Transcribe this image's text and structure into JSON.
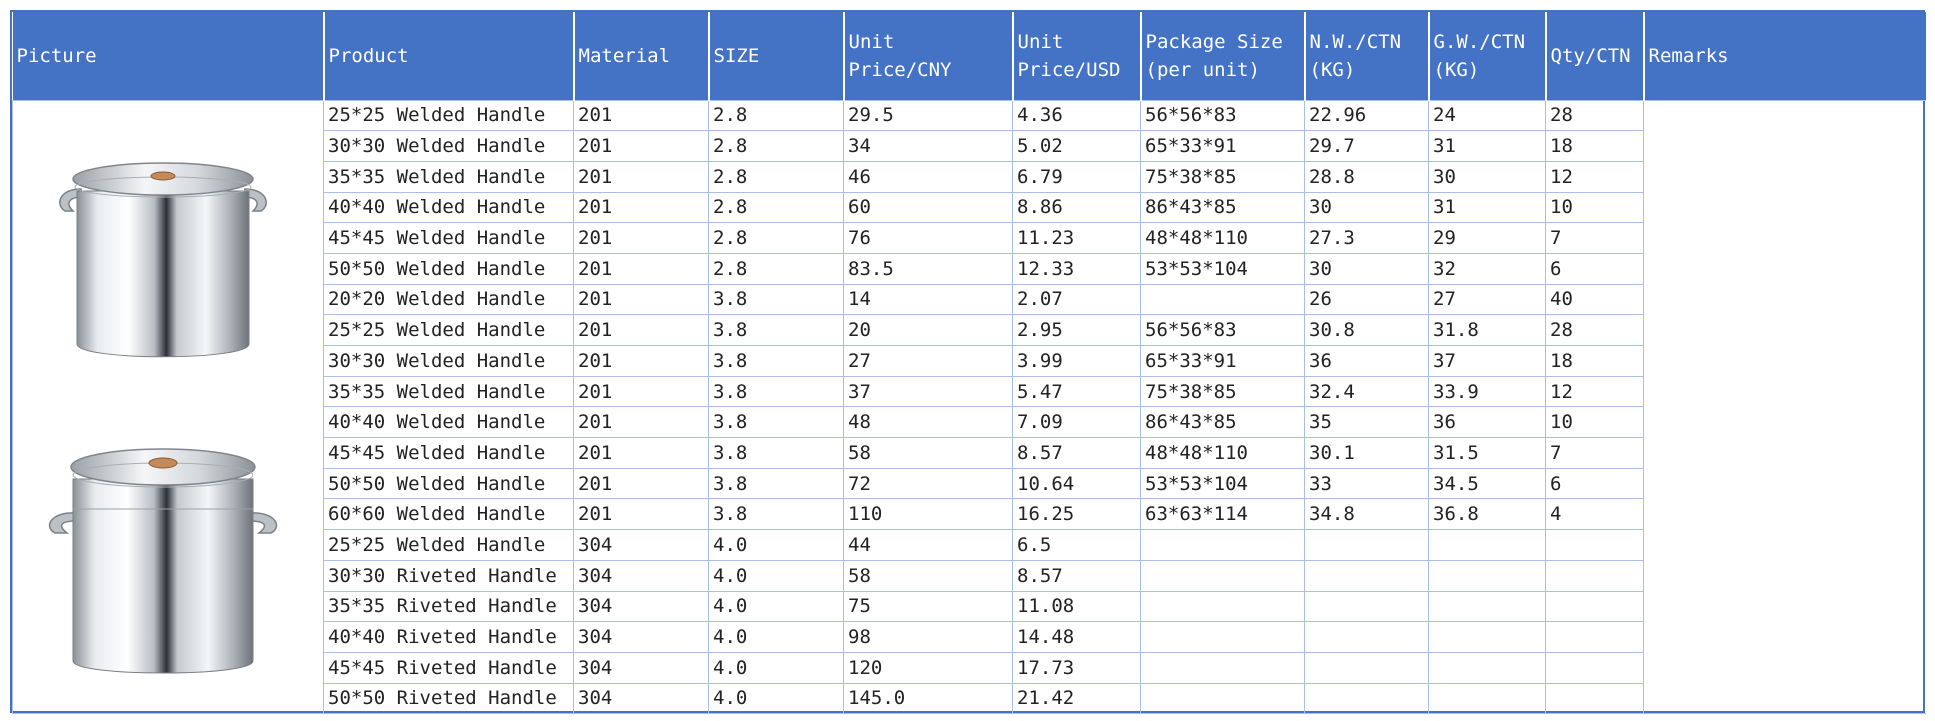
{
  "headers": {
    "picture": "Picture",
    "product": "Product",
    "material": "Material",
    "size": "SIZE",
    "unit_price_cny": "Unit\nPrice/CNY",
    "unit_price_usd": "Unit\nPrice/USD",
    "package_size": "Package Size\n(per unit)",
    "nw_ctn": "N.W./CTN\n(KG)",
    "gw_ctn": "G.W./CTN\n(KG)",
    "qty_ctn": "Qty/CTN",
    "remarks": "Remarks"
  },
  "images": [
    {
      "icon": "stock-pot-welded-handle-image"
    },
    {
      "icon": "stock-pot-riveted-handle-image"
    }
  ],
  "rows": [
    [
      "25*25 Welded Handle",
      "201",
      "2.8",
      "29.5",
      "4.36",
      "56*56*83",
      "22.96",
      "24",
      "28"
    ],
    [
      "30*30 Welded Handle",
      "201",
      "2.8",
      "34",
      "5.02",
      "65*33*91",
      "29.7",
      "31",
      "18"
    ],
    [
      "35*35 Welded Handle",
      "201",
      "2.8",
      "46",
      "6.79",
      "75*38*85",
      "28.8",
      "30",
      "12"
    ],
    [
      "40*40 Welded Handle",
      "201",
      "2.8",
      "60",
      "8.86",
      "86*43*85",
      "30",
      "31",
      "10"
    ],
    [
      "45*45 Welded Handle",
      "201",
      "2.8",
      "76",
      "11.23",
      "48*48*110",
      "27.3",
      "29",
      "7"
    ],
    [
      "50*50 Welded Handle",
      "201",
      "2.8",
      "83.5",
      "12.33",
      "53*53*104",
      "30",
      "32",
      "6"
    ],
    [
      "20*20 Welded Handle",
      "201",
      "3.8",
      "14",
      "2.07",
      "",
      "26",
      "27",
      "40"
    ],
    [
      "25*25 Welded Handle",
      "201",
      "3.8",
      "20",
      "2.95",
      "56*56*83",
      "30.8",
      "31.8",
      "28"
    ],
    [
      "30*30 Welded Handle",
      "201",
      "3.8",
      "27",
      "3.99",
      "65*33*91",
      "36",
      "37",
      "18"
    ],
    [
      "35*35 Welded Handle",
      "201",
      "3.8",
      "37",
      "5.47",
      "75*38*85",
      "32.4",
      "33.9",
      "12"
    ],
    [
      "40*40 Welded Handle",
      "201",
      "3.8",
      "48",
      "7.09",
      "86*43*85",
      "35",
      "36",
      "10"
    ],
    [
      "45*45 Welded Handle",
      "201",
      "3.8",
      "58",
      "8.57",
      "48*48*110",
      "30.1",
      "31.5",
      "7"
    ],
    [
      "50*50 Welded Handle",
      "201",
      "3.8",
      "72",
      "10.64",
      "53*53*104",
      "33",
      "34.5",
      "6"
    ],
    [
      "60*60 Welded Handle",
      "201",
      "3.8",
      "110",
      "16.25",
      "63*63*114",
      "34.8",
      "36.8",
      "4"
    ],
    [
      "25*25 Welded Handle",
      "304",
      "4.0",
      "44",
      "6.5",
      "",
      "",
      "",
      ""
    ],
    [
      "30*30 Riveted Handle",
      "304",
      "4.0",
      "58",
      "8.57",
      "",
      "",
      "",
      ""
    ],
    [
      "35*35 Riveted Handle",
      "304",
      "4.0",
      "75",
      "11.08",
      "",
      "",
      "",
      ""
    ],
    [
      "40*40 Riveted Handle",
      "304",
      "4.0",
      "98",
      "14.48",
      "",
      "",
      "",
      ""
    ],
    [
      "45*45 Riveted Handle",
      "304",
      "4.0",
      "120",
      "17.73",
      "",
      "",
      "",
      ""
    ],
    [
      "50*50 Riveted Handle",
      "304",
      "4.0",
      "145.0",
      "21.42",
      "",
      "",
      "",
      ""
    ]
  ]
}
